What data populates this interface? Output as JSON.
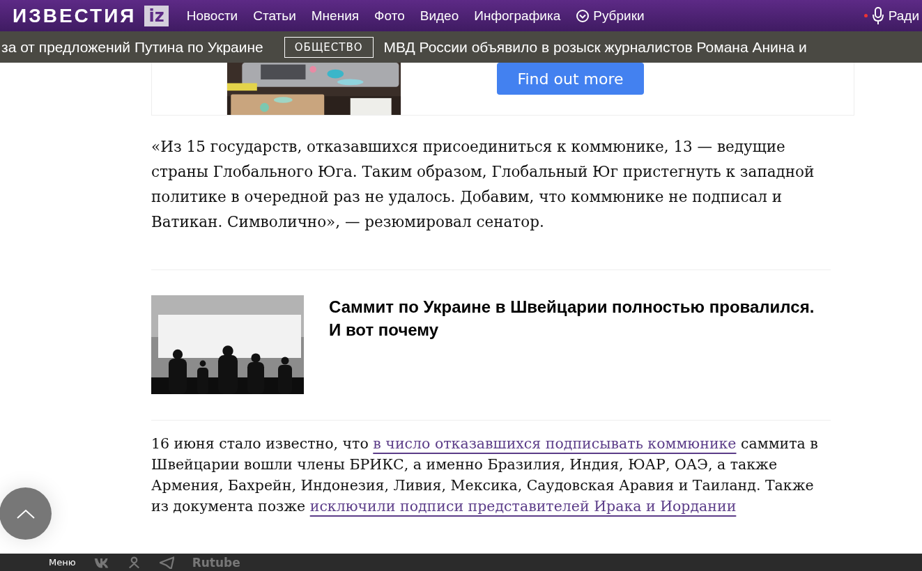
{
  "header": {
    "logo": "ИЗВЕСТИЯ",
    "logo_mark": "iz",
    "nav": [
      {
        "label": "Новости",
        "kind": "link"
      },
      {
        "label": "Статьи",
        "kind": "link"
      },
      {
        "label": "Мнения",
        "kind": "link"
      },
      {
        "label": "Фото",
        "kind": "link"
      },
      {
        "label": "Видео",
        "kind": "link"
      },
      {
        "label": "Инфографика",
        "kind": "link"
      },
      {
        "label": "Рубрики",
        "kind": "dropdown"
      }
    ],
    "radio": {
      "label": "Ради",
      "live": true
    }
  },
  "ticker": [
    {
      "kind": "headline",
      "text": "за от предложений Путина по Украине"
    },
    {
      "kind": "tag",
      "text": "ОБЩЕСТВО"
    },
    {
      "kind": "headline",
      "text": "МВД России объявило в розыск журналистов Романа Анина и"
    }
  ],
  "ad": {
    "button": "Find out more"
  },
  "quote": "«Из 15 государств, отказавшихся присоединиться к коммюнике, 13 — ведущие страны Глобального Юга. Таким образом, Глобальный Юг пристегнуть к западной политике в очередной раз не удалось. Добавим, что коммюнике не подписал и Ватикан. Символично», — резюмировал сенатор.",
  "related": {
    "title": "Саммит по Украине в Швейцарии полностью провалился. И вот почему"
  },
  "paragraph": [
    {
      "kind": "text",
      "text": "16 июня стало известно, что "
    },
    {
      "kind": "link",
      "text": "в число отказавшихся подписывать коммюнике"
    },
    {
      "kind": "text",
      "text": " саммита в Швейцарии вошли члены БРИКС, а именно Бразилия, Индия, ЮАР, ОАЭ, а также Армения, Бахрейн, Индонезия, Ливия, Мексика, Саудовская Аравия и Таиланд. Также из документа позже "
    },
    {
      "kind": "link",
      "text": "исключили подписи представителей Ирака и Иордании"
    }
  ],
  "bottom_bar": {
    "menu": "Меню",
    "icons": [
      {
        "kind": "vk"
      },
      {
        "kind": "person"
      },
      {
        "kind": "telegram"
      }
    ],
    "video": "Rutube"
  }
}
